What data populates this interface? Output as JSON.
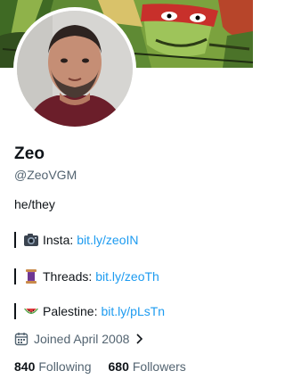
{
  "profile": {
    "name": "Zeo",
    "handle": "@ZeoVGM",
    "pronouns": "he/they"
  },
  "bio": [
    {
      "icon": "camera-icon",
      "label": "Insta:",
      "link": "bit.ly/zeoIN"
    },
    {
      "icon": "spool-of-thread-icon",
      "label": "Threads:",
      "link": "bit.ly/zeoTh"
    },
    {
      "icon": "watermelon-icon",
      "label": "Palestine:",
      "link": "bit.ly/pLsTn"
    }
  ],
  "joined": {
    "text": "Joined April 2008"
  },
  "stats": {
    "following_count": "840",
    "following_label": "Following",
    "followers_count": "680",
    "followers_label": "Followers"
  },
  "colors": {
    "link": "#1d9bf0",
    "secondary_text": "#536471",
    "primary_text": "#0f1419"
  }
}
